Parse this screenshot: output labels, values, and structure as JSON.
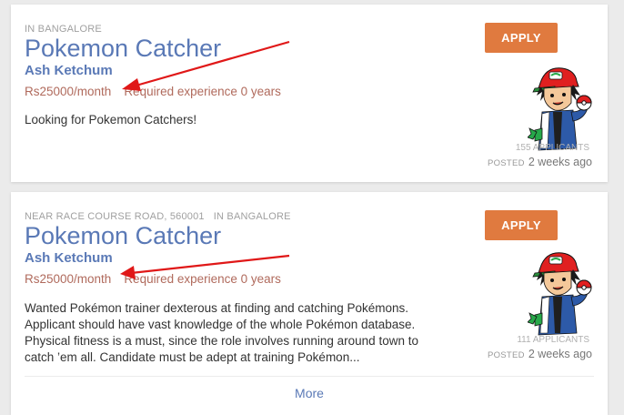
{
  "jobs": [
    {
      "location": "IN BANGALORE",
      "title": "Pokemon Catcher",
      "company": "Ash Ketchum",
      "salary": "Rs25000/month",
      "experience": "Required experience 0 years",
      "description": "Looking for Pokemon Catchers!",
      "apply_label": "APPLY",
      "applicants": "155 APPLICANTS",
      "posted_label": "POSTED",
      "posted_time": "2 weeks ago"
    },
    {
      "address": "NEAR RACE COURSE ROAD, 560001",
      "location": "IN BANGALORE",
      "title": "Pokemon Catcher",
      "company": "Ash Ketchum",
      "salary": "Rs25000/month",
      "experience": "Required experience 0 years",
      "description": "Wanted Pokémon trainer dexterous at finding and catching Pokémons. Applicant should have vast knowledge of the whole Pokémon database. Physical fitness is a must, since the role involves running around town to catch ’em all. Candidate must be adept at training Pokémon...",
      "apply_label": "APPLY",
      "applicants": "111 APPLICANTS",
      "posted_label": "POSTED",
      "posted_time": "2 weeks ago",
      "more_label": "More"
    }
  ],
  "colors": {
    "title": "#5a79b6",
    "salary": "#b06a5c",
    "apply_button": "#e07a3f",
    "annotation_arrow": "#e01818"
  },
  "icons": {
    "avatar": "ash-ketchum-avatar-icon",
    "annotation": "red-arrow-icon"
  }
}
